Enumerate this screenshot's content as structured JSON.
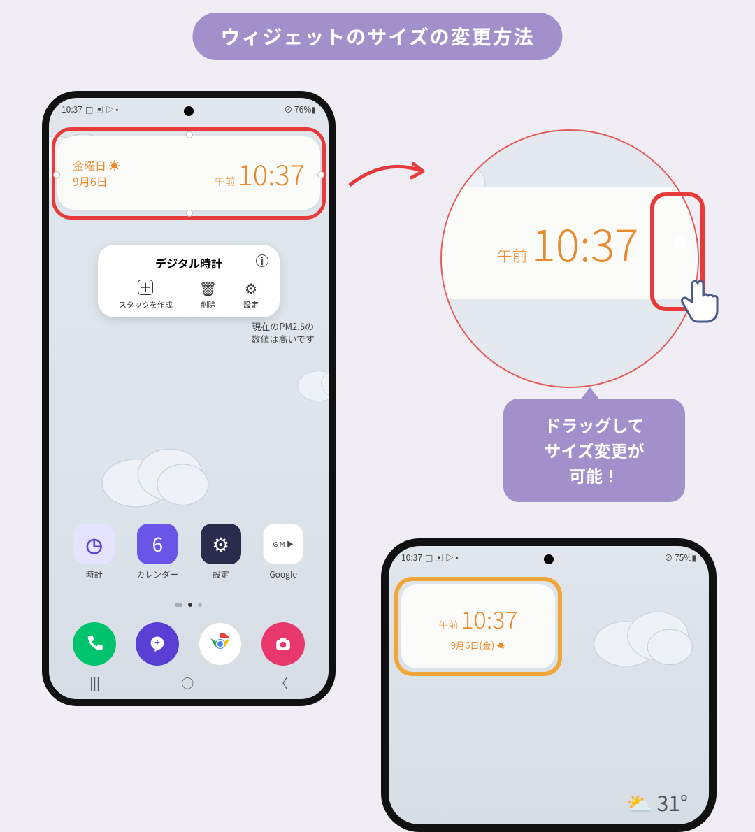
{
  "title": "ウィジェットのサイズの変更方法",
  "phone1": {
    "status": {
      "time": "10:37",
      "icons": "◫ ▣ ▷ •",
      "right": "⊘ 76%▮"
    },
    "widget": {
      "day": "金曜日",
      "sun": "☀",
      "date": "9月6日",
      "ampm": "午前",
      "time": "10:37"
    },
    "popup": {
      "title": "デジタル時計",
      "actions": [
        {
          "icon": "＋",
          "label": "スタックを作成"
        },
        {
          "icon": "🗑",
          "label": "削除"
        },
        {
          "icon": "⚙",
          "label": "設定"
        }
      ]
    },
    "pm25_line1": "現在のPM2.5の",
    "pm25_line2": "数値は高いです",
    "apps": [
      {
        "label": "時計",
        "glyph": "◷"
      },
      {
        "label": "カレンダー",
        "glyph": "6"
      },
      {
        "label": "設定",
        "glyph": "⚙"
      },
      {
        "label": "Google",
        "glyph": "G M ▶"
      }
    ]
  },
  "magnifier": {
    "ampm": "午前",
    "time": "10:37"
  },
  "tooltip": {
    "line1": "ドラッグして",
    "line2": "サイズ変更が",
    "line3": "可能！"
  },
  "phone2": {
    "status": {
      "time": "10:37",
      "icons": "◫ ▣ ▷ •",
      "right": "⊘ 75%▮"
    },
    "widget": {
      "ampm": "午前",
      "time": "10:37",
      "date": "9月6日(金)",
      "sun": "☀"
    },
    "weather": {
      "icon": "⛅",
      "temp": "31°"
    }
  }
}
